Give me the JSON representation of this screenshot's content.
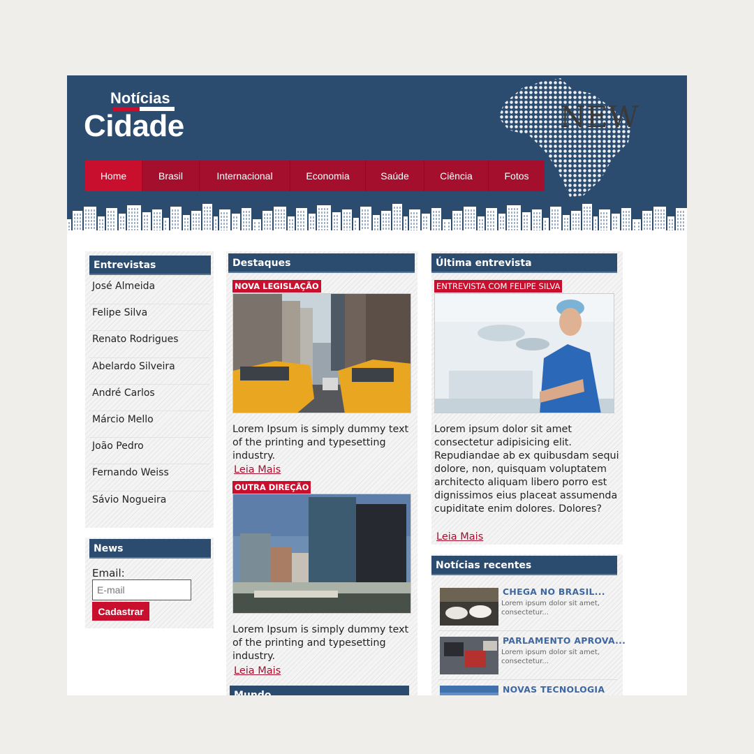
{
  "logo": {
    "top": "Notícias",
    "main": "Cidade"
  },
  "badge": "NEW",
  "nav": [
    {
      "label": "Home"
    },
    {
      "label": "Brasil"
    },
    {
      "label": "Internacional"
    },
    {
      "label": "Economia"
    },
    {
      "label": "Saúde"
    },
    {
      "label": "Ciência"
    },
    {
      "label": "Fotos"
    }
  ],
  "interviews": {
    "title": "Entrevistas",
    "items": [
      "José Almeida",
      "Felipe Silva",
      "Renato Rodrigues",
      "Abelardo Silveira",
      "André Carlos",
      "Márcio Mello",
      "João Pedro",
      "Fernando Weiss",
      "Sávio Nogueira"
    ]
  },
  "newsletter": {
    "title": "News",
    "email_label": "Email:",
    "email_placeholder": "E-mail",
    "button": "Cadastrar"
  },
  "highlights": {
    "title": "Destaques",
    "articles": [
      {
        "tag": "NOVA LEGISLAÇÃO",
        "image": "city-taxi-street-photo",
        "text": "Lorem Ipsum is simply dummy text of the printing and typesetting industry.",
        "link": "Leia Mais"
      },
      {
        "tag": "OUTRA DIREÇÃO",
        "image": "waterfront-office-buildings-photo",
        "text": "Lorem Ipsum is simply dummy text of the printing and typesetting industry.",
        "link": "Leia Mais"
      }
    ],
    "next_section_title": "Mundo"
  },
  "last_interview": {
    "title": "Última entrevista",
    "tag": "ENTREVISTA COM FELIPE SILVA",
    "image": "surgeon-in-operating-room-photo",
    "text": "Lorem ipsum dolor sit amet consectetur adipisicing elit. Repudiandae ab ex quibusdam sequi dolore, non, quisquam voluptatem architecto aliquam libero porro est dignissimos eius placeat assumenda cupiditate enim dolores. Dolores?",
    "link": "Leia Mais"
  },
  "recent": {
    "title": "Notícias recentes",
    "items": [
      {
        "title": "CHEGA NO BRASIL...",
        "text": "Lorem ipsum dolor sit amet, consectetur...",
        "image": "game-controllers-photo"
      },
      {
        "title": "PARLAMENTO APROVA...",
        "text": "Lorem ipsum dolor sit amet, consectetur...",
        "image": "desk-notebook-photo"
      },
      {
        "title": "NOVAS TECNOLOGIA",
        "text": "",
        "image": "sky-photo"
      }
    ]
  },
  "colors": {
    "navy": "#2b4b6f",
    "crimson": "#c8102e",
    "dark_crimson": "#a30f2d",
    "link_blue": "#3d67a1",
    "page_bg": "#efeeea"
  }
}
